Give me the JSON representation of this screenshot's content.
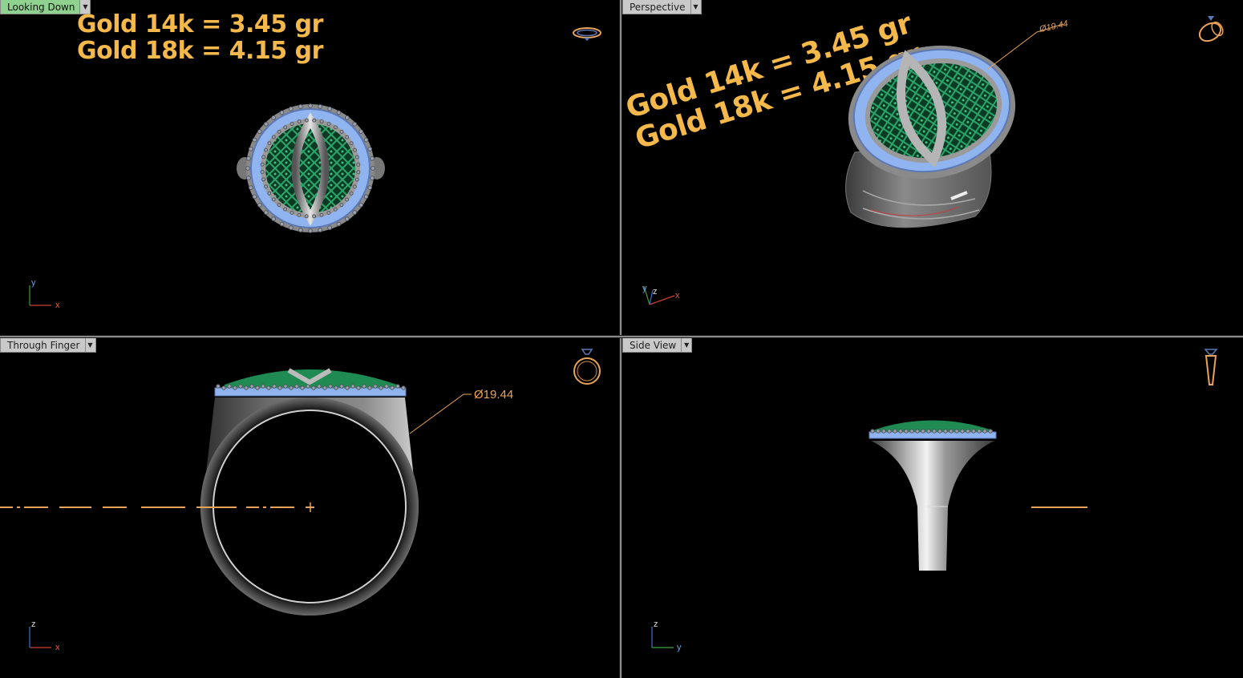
{
  "viewports": {
    "top_left": {
      "label": "Looking Down",
      "active": true,
      "gold_lines": [
        "Gold 14k = 3.45 gr",
        "Gold 18k = 4.15 gr"
      ],
      "axes": [
        "y",
        "x"
      ]
    },
    "top_right": {
      "label": "Perspective",
      "active": false,
      "gold_lines": [
        "Gold 14k = 3.45 gr",
        "Gold 18k = 4.15 gr"
      ],
      "dimension": "Ø19.44",
      "axes": [
        "y",
        "z",
        "x"
      ]
    },
    "bottom_left": {
      "label": "Through Finger",
      "active": false,
      "dimension": "Ø19.44",
      "axes": [
        "z",
        "x"
      ]
    },
    "bottom_right": {
      "label": "Side View",
      "active": false,
      "axes": [
        "z",
        "y"
      ]
    }
  },
  "colors": {
    "gold_text": "#f5b84a",
    "dimension": "#e8a35a",
    "metal": "#8a8a8a",
    "gem_blue": "#8fb4f0",
    "mesh_green": "#1f8a52",
    "active_tab": "#8fd18f"
  }
}
